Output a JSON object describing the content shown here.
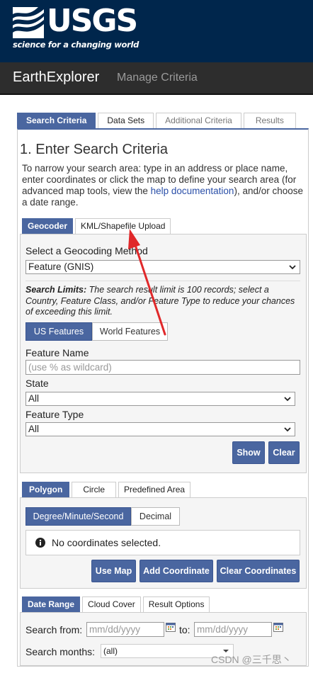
{
  "header": {
    "logo_text": "USGS",
    "logo_tagline": "science for a changing world",
    "app_title": "EarthExplorer",
    "manage_criteria": "Manage Criteria"
  },
  "main_tabs": [
    "Search Criteria",
    "Data Sets",
    "Additional Criteria",
    "Results"
  ],
  "section_title": "1. Enter Search Criteria",
  "intro": {
    "before_link": "To narrow your search area: type in an address or place name, enter coordinates or click the map to define your search area (for advanced map tools, view the ",
    "link": "help documentation",
    "after_link": "), and/or choose a date range."
  },
  "geocoder_tabs": [
    "Geocoder",
    "KML/Shapefile Upload"
  ],
  "geocoder": {
    "method_label": "Select a Geocoding Method",
    "method_value": "Feature (GNIS)",
    "limits_bold": "Search Limits:",
    "limits_text": " The search result limit is 100 records; select a Country, Feature Class, and/or Feature Type to reduce your chances of exceeding this limit.",
    "feature_toggle": [
      "US Features",
      "World Features"
    ],
    "feature_name_label": "Feature Name",
    "feature_name_placeholder": "(use % as wildcard)",
    "state_label": "State",
    "state_value": "All",
    "feature_type_label": "Feature Type",
    "feature_type_value": "All",
    "show_btn": "Show",
    "clear_btn": "Clear"
  },
  "area_tabs": [
    "Polygon",
    "Circle",
    "Predefined Area"
  ],
  "polygon": {
    "coord_toggle": [
      "Degree/Minute/Second",
      "Decimal"
    ],
    "no_coords": "No coordinates selected.",
    "use_map": "Use Map",
    "add_coord": "Add Coordinate",
    "clear_coords": "Clear Coordinates"
  },
  "date_tabs": [
    "Date Range",
    "Cloud Cover",
    "Result Options"
  ],
  "date": {
    "from_label": "Search from:",
    "from_placeholder": "mm/dd/yyyy",
    "to_label": "to:",
    "to_placeholder": "mm/dd/yyyy",
    "months_label": "Search months:",
    "months_value": "(all)"
  },
  "watermark": "CSDN @三千思丶",
  "colors": {
    "usgs_navy": "#00264c",
    "tab_blue": "#4a66a0",
    "annotation_red": "#e0282a"
  }
}
